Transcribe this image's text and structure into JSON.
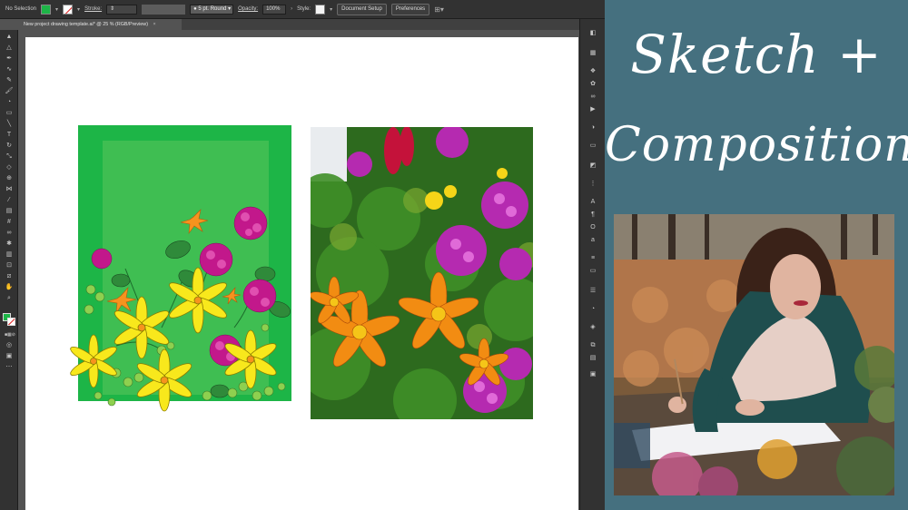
{
  "control_bar": {
    "selection_label": "No Selection",
    "fill_color": "#1db547",
    "stroke_label": "Stroke:",
    "brush_label": "5 pt. Round",
    "opacity_label": "Opacity:",
    "opacity_value": "100%",
    "style_label": "Style:",
    "document_setup_label": "Document Setup",
    "preferences_label": "Preferences"
  },
  "document_tab": {
    "title": "New project drawing template.ai* @ 25 % (RGB/Preview)",
    "close_glyph": "×"
  },
  "tools": [
    "selection-tool",
    "direct-selection-tool",
    "pen-tool",
    "curvature-tool",
    "pencil-tool",
    "paintbrush-tool",
    "blob-brush-tool",
    "rectangle-tool",
    "line-tool",
    "type-tool",
    "rotate-tool",
    "scale-tool",
    "eraser-tool",
    "shape-builder-tool",
    "width-tool",
    "eyedropper-tool",
    "gradient-tool",
    "mesh-tool",
    "blend-tool",
    "symbol-sprayer-tool",
    "graph-tool",
    "artboard-tool",
    "slice-tool",
    "hand-tool",
    "zoom-tool"
  ],
  "panel_icons": [
    "color-icon",
    "swatches-icon",
    "brushes-icon",
    "symbols-icon",
    "graphic-styles-icon",
    "appearance-icon",
    "stroke-icon",
    "gradient-icon",
    "transparency-icon",
    "character-icon",
    "paragraph-icon",
    "opentype-icon",
    "align-icon",
    "pathfinder-icon",
    "transform-icon",
    "layers-icon",
    "artboards-icon",
    "libraries-icon",
    "links-icon"
  ],
  "title": {
    "line1": "Sketch +",
    "line2": "Composition",
    "background": "#45707f",
    "text_color": "#ffffff"
  },
  "colors": {
    "artboard_green": "#1db547",
    "inner_green": "#3fbe52",
    "flower_yellow": "#f8e81c",
    "flower_orange": "#f7931e",
    "flower_magenta": "#c2188b",
    "leaf_green": "#2f8a3a"
  }
}
